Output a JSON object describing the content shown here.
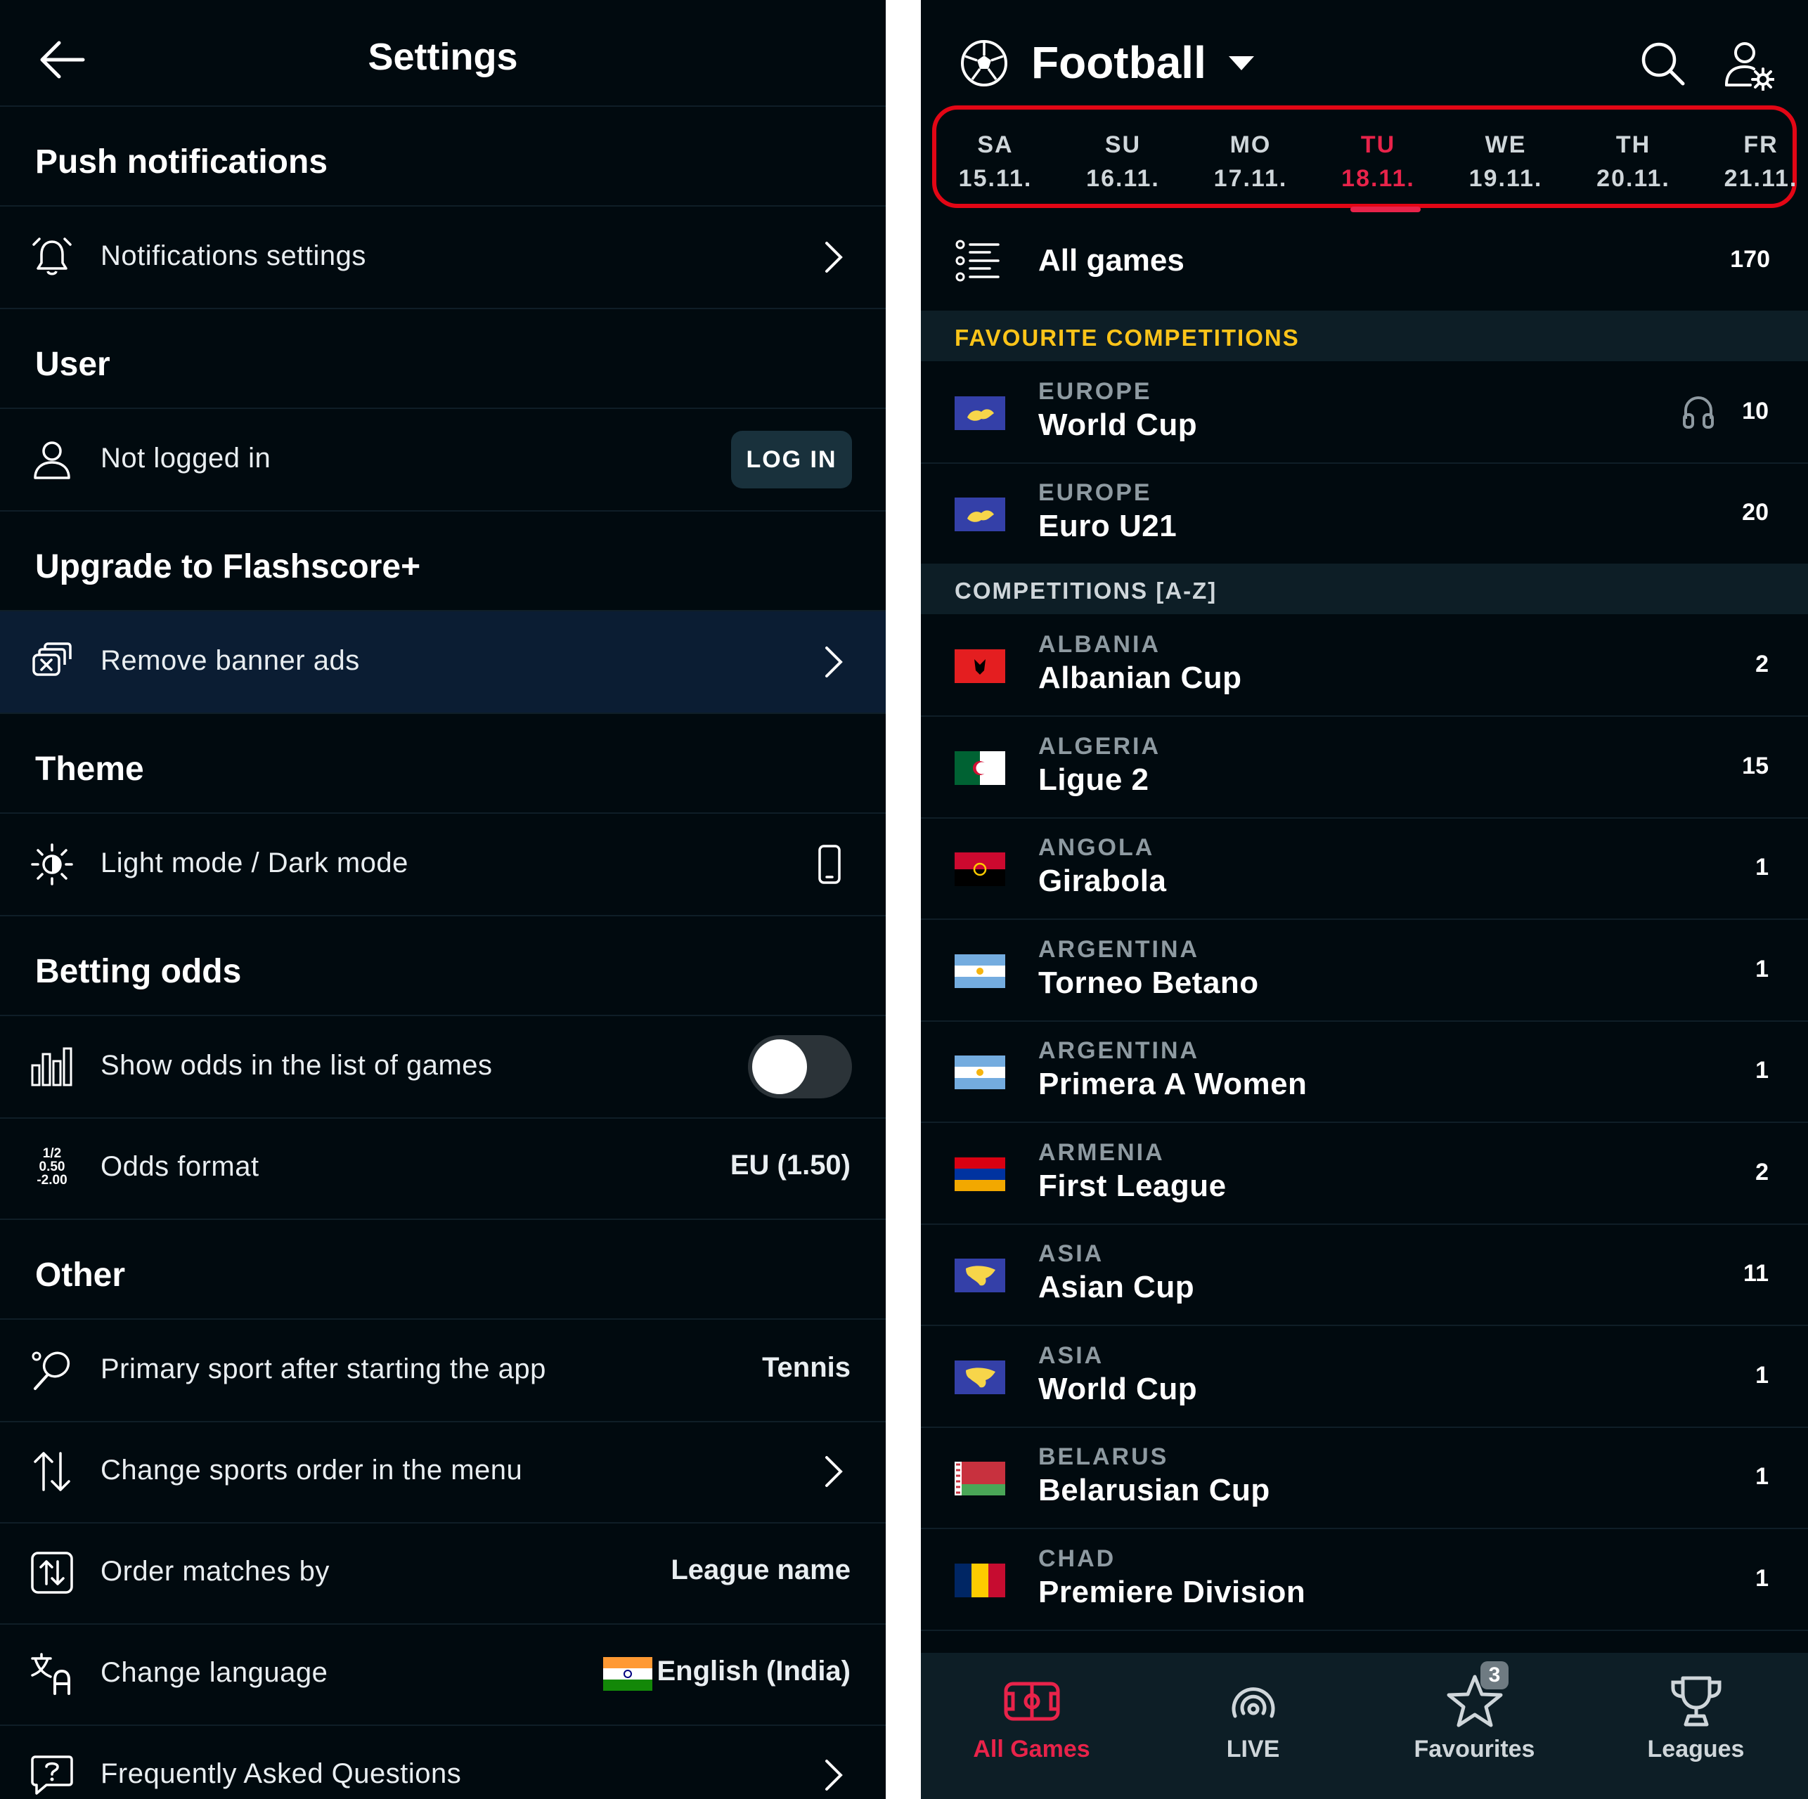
{
  "settings": {
    "title": "Settings",
    "sections": {
      "push": "Push notifications",
      "user": "User",
      "upgrade": "Upgrade to Flashscore+",
      "theme": "Theme",
      "betting": "Betting odds",
      "other": "Other"
    },
    "rows": {
      "notifications": "Notifications settings",
      "not_logged": "Not logged in",
      "login": "LOG IN",
      "remove_ads": "Remove banner ads",
      "theme_mode": "Light mode / Dark mode",
      "show_odds": "Show odds in the list of games",
      "show_odds_enabled": false,
      "odds_format": "Odds format",
      "odds_format_value": "EU (1.50)",
      "odds_icon_lines": [
        "1/2",
        "0.50",
        "-2.00"
      ],
      "primary_sport": "Primary sport after starting the app",
      "primary_sport_value": "Tennis",
      "sports_order": "Change sports order in the menu",
      "order_matches": "Order matches by",
      "order_matches_value": "League name",
      "language": "Change language",
      "language_value": "English (India)",
      "faq": "Frequently Asked Questions"
    }
  },
  "football": {
    "title": "Football",
    "days": [
      {
        "d": "SA",
        "date": "15.11.",
        "active": false
      },
      {
        "d": "SU",
        "date": "16.11.",
        "active": false
      },
      {
        "d": "MO",
        "date": "17.11.",
        "active": false
      },
      {
        "d": "TU",
        "date": "18.11.",
        "active": true
      },
      {
        "d": "WE",
        "date": "19.11.",
        "active": false
      },
      {
        "d": "TH",
        "date": "20.11.",
        "active": false
      },
      {
        "d": "FR",
        "date": "21.11.",
        "active": false
      }
    ],
    "all_games": {
      "label": "All games",
      "count": "170"
    },
    "favourite_header": "FAVOURITE COMPETITIONS",
    "az_header": "COMPETITIONS [A-Z]",
    "favourites": [
      {
        "country": "EUROPE",
        "name": "World Cup",
        "count": "10",
        "audio": true
      },
      {
        "country": "EUROPE",
        "name": "Euro U21",
        "count": "20",
        "audio": false
      }
    ],
    "competitions": [
      {
        "country": "ALBANIA",
        "name": "Albanian Cup",
        "count": "2"
      },
      {
        "country": "ALGERIA",
        "name": "Ligue 2",
        "count": "15"
      },
      {
        "country": "ANGOLA",
        "name": "Girabola",
        "count": "1"
      },
      {
        "country": "ARGENTINA",
        "name": "Torneo Betano",
        "count": "1"
      },
      {
        "country": "ARGENTINA",
        "name": "Primera A Women",
        "count": "1"
      },
      {
        "country": "ARMENIA",
        "name": "First League",
        "count": "2"
      },
      {
        "country": "ASIA",
        "name": "Asian Cup",
        "count": "11"
      },
      {
        "country": "ASIA",
        "name": "World Cup",
        "count": "1"
      },
      {
        "country": "BELARUS",
        "name": "Belarusian Cup",
        "count": "1"
      },
      {
        "country": "CHAD",
        "name": "Premiere Division",
        "count": "1"
      }
    ],
    "nav": [
      {
        "label": "All Games",
        "active": true
      },
      {
        "label": "LIVE",
        "active": false
      },
      {
        "label": "Favourites",
        "active": false,
        "badge": "3"
      },
      {
        "label": "Leagues",
        "active": false
      }
    ]
  },
  "colors": {
    "accent_red": "#e8234a",
    "highlight_box": "#e30615",
    "favourite_yellow": "#fcc419",
    "background": "#010a0f"
  }
}
